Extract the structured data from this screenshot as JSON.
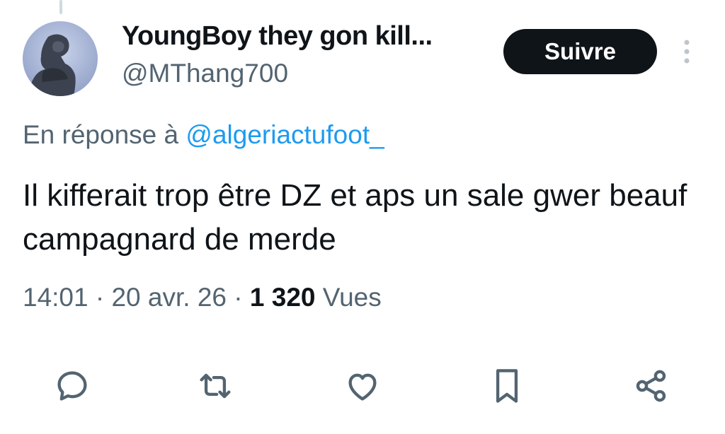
{
  "author": {
    "display_name": "YoungBoy they gon kill...",
    "handle": "@MThang700",
    "avatar_icon": "statue-avatar"
  },
  "follow_button": {
    "label": "Suivre"
  },
  "more_menu_icon": "more-vertical-icon",
  "reply": {
    "prefix": "En réponse à",
    "mention": "@algeriactufoot_"
  },
  "tweet": {
    "text": "Il kifferait trop être DZ et aps un sale gwer beauf campagnard de merde"
  },
  "meta": {
    "time": "14:01",
    "separator": "·",
    "date": "20 avr. 26",
    "views_count": "1 320",
    "views_label": "Vues"
  },
  "actions": [
    {
      "name": "reply",
      "icon": "comment-icon"
    },
    {
      "name": "retweet",
      "icon": "retweet-icon"
    },
    {
      "name": "like",
      "icon": "heart-icon"
    },
    {
      "name": "bookmark",
      "icon": "bookmark-icon"
    },
    {
      "name": "share",
      "icon": "share-icon"
    }
  ],
  "colors": {
    "text_primary": "#0f1419",
    "text_secondary": "#536471",
    "link": "#1d9bf0",
    "button_bg": "#0f1419"
  }
}
